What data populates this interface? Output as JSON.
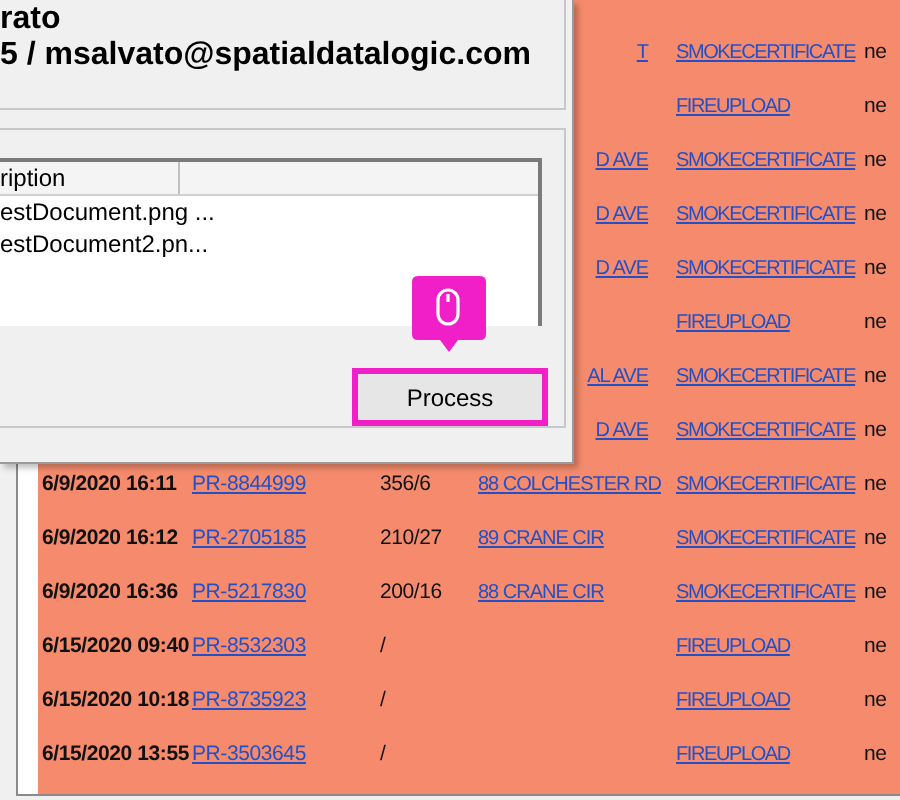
{
  "records": [
    {
      "address": "T",
      "type": "SMOKECERTIFICATE",
      "status": "ne"
    },
    {
      "type": "FIREUPLOAD",
      "status": "ne"
    },
    {
      "address": "D AVE",
      "type": "SMOKECERTIFICATE",
      "status": "ne"
    },
    {
      "address": "D AVE",
      "type": "SMOKECERTIFICATE",
      "status": "ne"
    },
    {
      "address": "D AVE",
      "type": "SMOKECERTIFICATE",
      "status": "ne"
    },
    {
      "type": "FIREUPLOAD",
      "status": "ne"
    },
    {
      "address": "AL AVE",
      "type": "SMOKECERTIFICATE",
      "status": "ne"
    },
    {
      "address": "D AVE",
      "type": "SMOKECERTIFICATE",
      "status": "ne"
    },
    {
      "date": "6/9/2020 16:11",
      "permit": "PR-8844999",
      "number": "356/6",
      "address": "88 COLCHESTER RD",
      "type": "SMOKECERTIFICATE",
      "status": "ne"
    },
    {
      "date": "6/9/2020 16:12",
      "permit": "PR-2705185",
      "number": "210/27",
      "address": "89 CRANE CIR",
      "type": "SMOKECERTIFICATE",
      "status": "ne"
    },
    {
      "date": "6/9/2020 16:36",
      "permit": "PR-5217830",
      "number": "200/16",
      "address": "88 CRANE CIR",
      "type": "SMOKECERTIFICATE",
      "status": "ne"
    },
    {
      "date": "6/15/2020 09:40",
      "permit": "PR-8532303",
      "number": "/",
      "type": "FIREUPLOAD",
      "status": "ne"
    },
    {
      "date": "6/15/2020 10:18",
      "permit": "PR-8735923",
      "number": "/",
      "type": "FIREUPLOAD",
      "status": "ne"
    },
    {
      "date": "6/15/2020 13:55",
      "permit": "PR-3503645",
      "number": "/",
      "type": "FIREUPLOAD",
      "status": "ne"
    }
  ],
  "dialog": {
    "user_lines": [
      "rato",
      "5 / msalvato@spatialdatalogic.com"
    ],
    "file_list": {
      "columns": [
        "ription"
      ],
      "rows": [
        "estDocument.png ...",
        "estDocument2.pn..."
      ]
    },
    "process_button": "Process"
  }
}
